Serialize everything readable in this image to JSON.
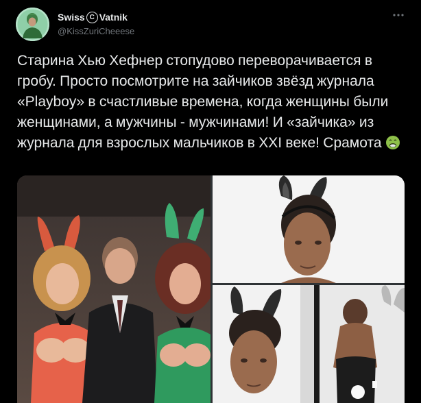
{
  "tweet": {
    "author": {
      "name_left": "Swiss",
      "name_symbol": "C",
      "name_right": "Vatnik",
      "handle": "@KissZuriCheeese"
    },
    "text_main": "Старина Хью Хефнер стопудово переворачивается в гробу. Просто посмотрите на зайчиков звёзд журнала «Playboy» в счастливые времена, когда женщины были женщинами, а мужчины - мужчинами! И «зайчика» из журнала для взрослых мальчиков в XXI веке! Срамота",
    "emoji_name": "nauseated-face",
    "media": [
      {
        "name": "photo-hefner-with-bunnies"
      },
      {
        "name": "photo-bunny-ears-portrait"
      },
      {
        "name": "photo-bunny-ears-collage"
      }
    ]
  },
  "colors": {
    "background": "#000000",
    "text_primary": "#e7e9ea",
    "text_secondary": "#71767b"
  }
}
